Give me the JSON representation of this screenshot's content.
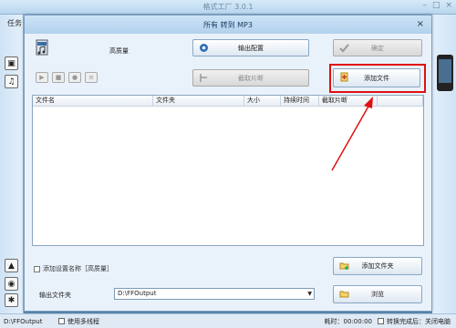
{
  "app": {
    "title": "格式工厂 3.0.1",
    "menu_label": "任务"
  },
  "dialog": {
    "title": "所有 转到 MP3",
    "close_glyph": "×",
    "quality_label": "高质量",
    "buttons": {
      "output_config": "输出配置",
      "ok": "确定",
      "clip": "截取片断",
      "add_file": "添加文件",
      "add_folder": "添加文件夹",
      "browse": "浏览"
    },
    "table_headers": [
      "文件名",
      "文件夹",
      "大小",
      "持续时间",
      "截取片断"
    ],
    "add_setting_name_label": "添加设置名称［高质量］",
    "output_folder_label": "输出文件夹",
    "output_folder_value": "D:\\FFOutput"
  },
  "status": {
    "path": "D:\\FFOutput",
    "multithread_label": "使用多线程",
    "elapsed": "耗时：00:00:00",
    "after_convert": "转换完成后：关闭电脑"
  },
  "colors": {
    "highlight": "#e01010",
    "accent": "#b2d1ec"
  },
  "icons": [
    "mp3-icon",
    "gear-icon",
    "check-icon",
    "add-file-icon",
    "add-folder-icon",
    "folder-icon",
    "dropdown-icon"
  ]
}
